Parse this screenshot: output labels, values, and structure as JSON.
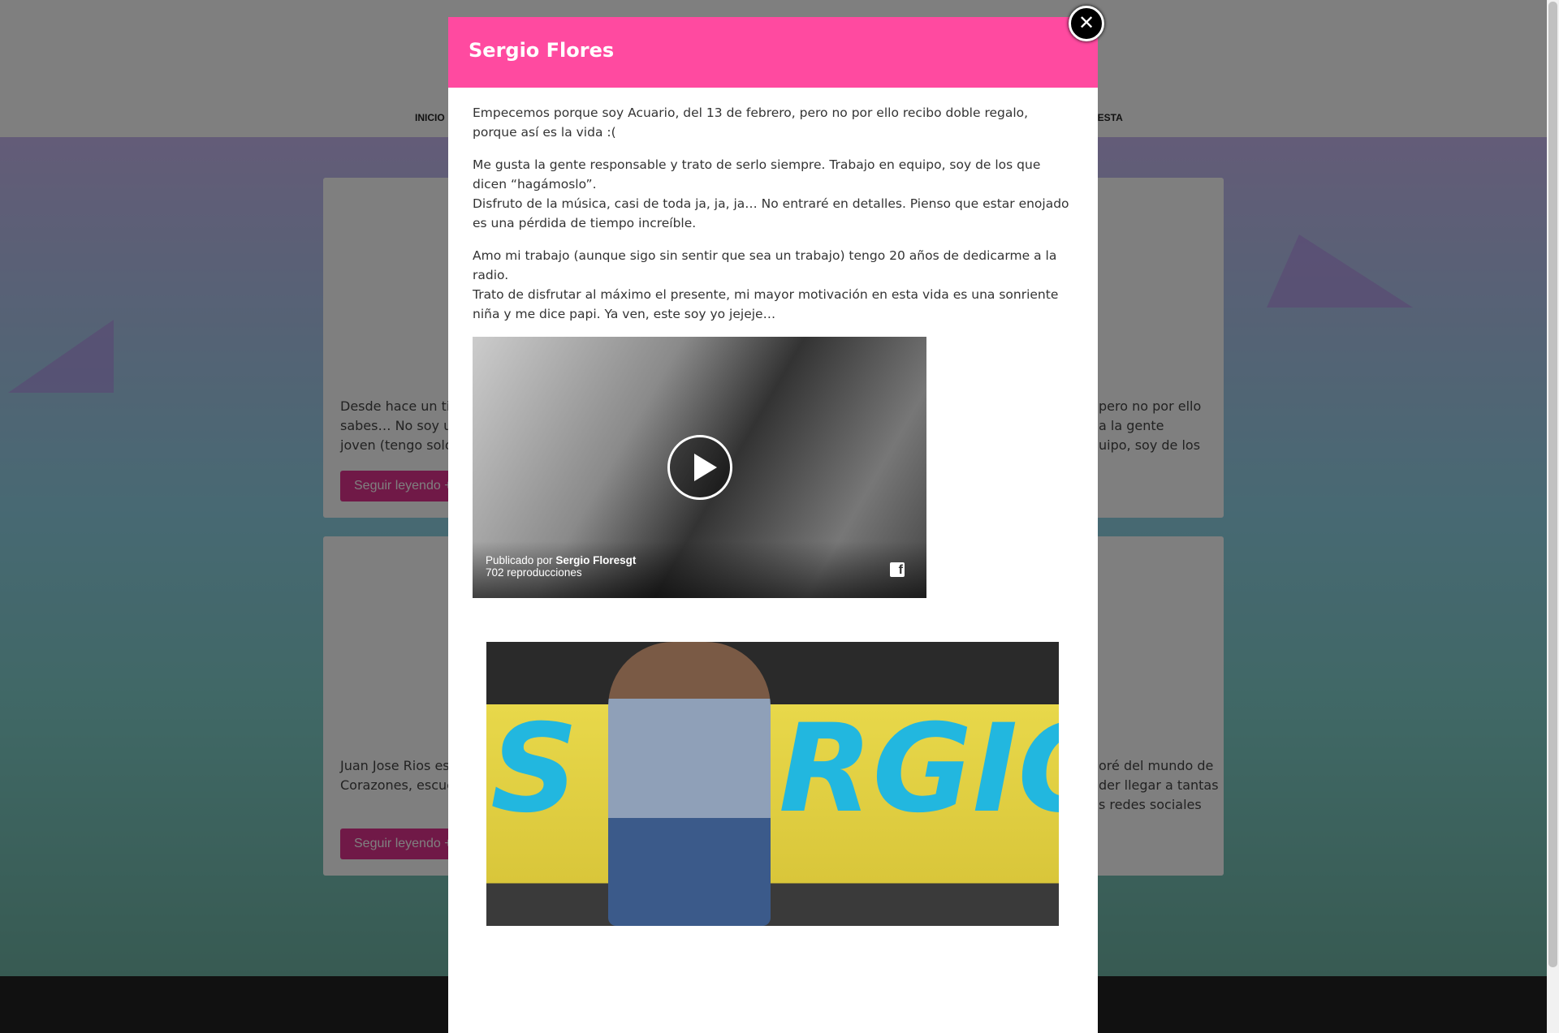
{
  "nav": {
    "items": [
      "INICIO",
      "UESTA"
    ]
  },
  "cards": [
    {
      "left_text": [
        "Desde hace un tiem",
        "sabes… No soy un",
        "joven   (tengo solo"
      ],
      "right_text": [
        "pero no por ello",
        "a la gente",
        "uipo, soy de los"
      ],
      "button": "Seguir leyendo +"
    },
    {
      "left_text": [
        "Juan Jose Rios es p",
        "Corazones, escucha"
      ],
      "right_text": [
        "oré del mundo de",
        "der llegar a tantas",
        "s redes sociales"
      ],
      "button": "Seguir leyendo +"
    }
  ],
  "modal": {
    "title": "Sergio Flores",
    "close_icon": "close-icon",
    "paragraphs": [
      [
        "Empecemos porque soy Acuario, del 13 de febrero, pero no por ello recibo doble regalo, porque así es la vida :("
      ],
      [
        "Me gusta la gente responsable y trato de serlo siempre. Trabajo en equipo, soy de los que dicen “hagámoslo”.",
        "Disfruto de la música, casi de toda ja, ja, ja… No entraré en detalles. Pienso que estar enojado es una pérdida de tiempo increíble."
      ],
      [
        "Amo mi trabajo (aunque sigo sin sentir que sea un trabajo) tengo 20 años de dedicarme a la radio.",
        "Trato de disfrutar al máximo el presente, mi mayor motivación en esta vida es una sonriente niña y me dice papi. Ya ven, este soy yo jejeje…"
      ]
    ],
    "video": {
      "posted_by_label": "Publicado por",
      "author": "Sergio Floresgt",
      "views": "702 reproducciones",
      "fb_icon": "facebook-icon"
    },
    "photo": {
      "lettering": "S  RGIO"
    }
  },
  "colors": {
    "accent": "#ff4aa0",
    "button": "#e0338e"
  }
}
